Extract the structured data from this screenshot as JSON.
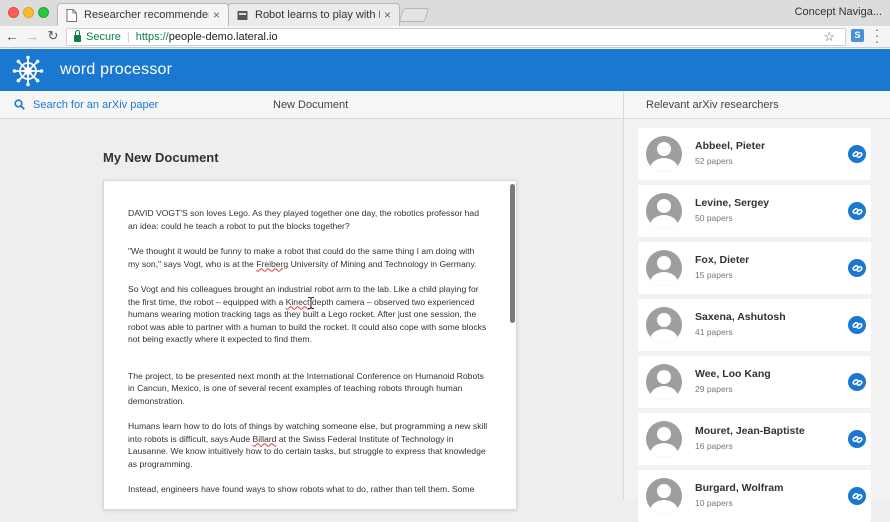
{
  "browser": {
    "tabs": [
      {
        "title": "Researcher recommender",
        "close": "×"
      },
      {
        "title": "Robot learns to play with Lego",
        "close": "×"
      }
    ],
    "profile_name": "Concept Naviga...",
    "secure_label": "Secure",
    "url_scheme": "https://",
    "url_host": "people-demo.lateral.io",
    "extension_badge": "S"
  },
  "app": {
    "title": "word processor",
    "brand_color": "#1b78d1"
  },
  "toolbar": {
    "search_label": "Search for an arXiv paper",
    "document_label": "New Document"
  },
  "document": {
    "heading": "My New Document",
    "paragraphs": {
      "p1": "DAVID VOGT'S son loves Lego. As they played together one day, the robotics professor had an idea: could he teach a robot to put the blocks together?",
      "p2_a": "\"We thought it would be funny to make a robot that could do the same thing I am doing with my son,\" says Vogt, who is at the ",
      "p2_misspelt": "Freiberg",
      "p2_b": " University of Mining and Technology in Germany.",
      "p3_a": "So Vogt and his colleagues brought an industrial robot arm to the lab. Like a child playing for the first time, the robot – equipped with a ",
      "p3_misspelt": "Kinect",
      "p3_b": " depth camera – observed two experienced humans wearing motion tracking tags as they built a Lego rocket. After just one session, the robot was able to partner with a human to build the rocket. It could also cope with some blocks not being exactly where it expected to find them.",
      "p4": "The project, to be presented next month at the International Conference on Humanoid Robots in Cancun, Mexico, is one of several recent examples of teaching robots through human demonstration.",
      "p5_a": "Humans learn how to do lots of things by watching someone else, but programming a new skill into robots is difficult, says Aude ",
      "p5_misspelt": "Billard",
      "p5_b": " at the Swiss Federal Institute of Technology in Lausanne. We know intuitively how to do certain tasks, but struggle to express that knowledge as programming.",
      "p6": "Instead, engineers have found ways to show robots what to do, rather than tell them. Some"
    }
  },
  "sidebar": {
    "title": "Relevant arXiv researchers",
    "researchers": [
      {
        "name": "Abbeel, Pieter",
        "papers": "52 papers"
      },
      {
        "name": "Levine, Sergey",
        "papers": "50 papers"
      },
      {
        "name": "Fox, Dieter",
        "papers": "15 papers"
      },
      {
        "name": "Saxena, Ashutosh",
        "papers": "41 papers"
      },
      {
        "name": "Wee, Loo Kang",
        "papers": "29 papers"
      },
      {
        "name": "Mouret, Jean-Baptiste",
        "papers": "16 papers"
      },
      {
        "name": "Burgard, Wolfram",
        "papers": "10 papers"
      }
    ]
  },
  "icons": {
    "logo": "ships-wheel-icon",
    "search": "search-icon",
    "researcher_action": "link-icon",
    "tab_favicon": "document-icon"
  }
}
